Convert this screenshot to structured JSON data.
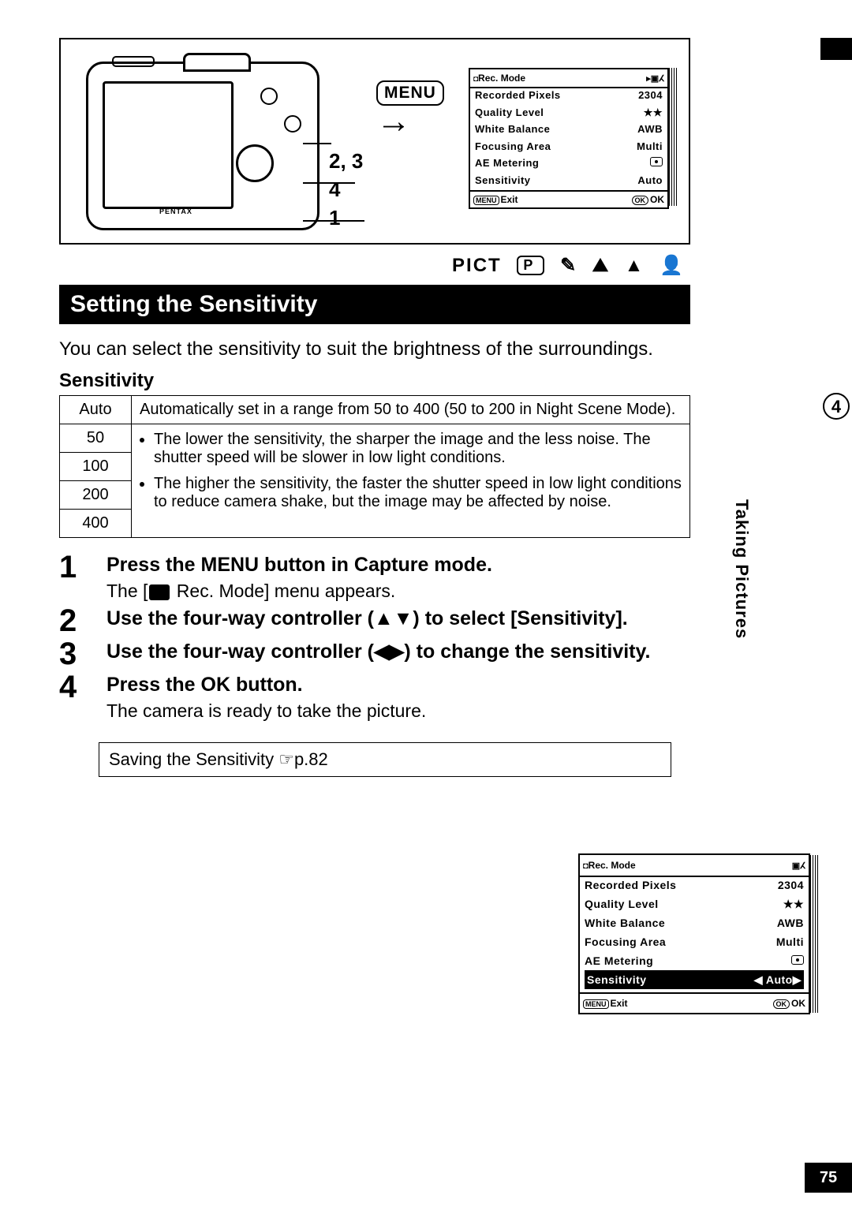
{
  "sidebar": {
    "chapter_number": "4",
    "chapter_title": "Taking Pictures",
    "page_number": "75"
  },
  "diagram": {
    "menu_button": "MENU",
    "step_2_3": "2, 3",
    "step_4": "4",
    "step_1": "1",
    "pentax": "PENTAX"
  },
  "lcd1": {
    "header_title": "Rec. Mode",
    "rows": [
      {
        "label": "Recorded Pixels",
        "value": "2304"
      },
      {
        "label": "Quality Level",
        "value": "★★"
      },
      {
        "label": "White Balance",
        "value": "AWB"
      },
      {
        "label": "Focusing Area",
        "value": "Multi"
      },
      {
        "label": "AE Metering",
        "value": "◉"
      },
      {
        "label": "Sensitivity",
        "value": "Auto"
      }
    ],
    "footer_menu": "MENU",
    "footer_exit": "Exit",
    "footer_ok": "OK",
    "footer_ok2": "OK"
  },
  "mode_row": {
    "pict": "PICT",
    "p": "P",
    "icons": "✎ ⛰ ▲ 👤"
  },
  "section_header": "Setting the Sensitivity",
  "intro": "You can select the sensitivity to suit the brightness of the surroundings.",
  "subhead": "Sensitivity",
  "table": {
    "auto_label": "Auto",
    "auto_desc": "Automatically set in a range from 50 to 400 (50 to 200 in Night Scene Mode).",
    "v50": "50",
    "v100": "100",
    "v200": "200",
    "v400": "400",
    "bullet1": "The lower the sensitivity, the sharper the image and the less noise. The shutter speed will be slower in low light conditions.",
    "bullet2": "The higher the sensitivity, the faster the shutter speed in low light conditions to reduce camera shake, but the image may be affected by noise."
  },
  "steps": {
    "s1": {
      "n": "1",
      "title": "Press the MENU button in Capture mode.",
      "sub_pre": "The [",
      "sub_post": " Rec. Mode] menu appears."
    },
    "s2": {
      "n": "2",
      "title": "Use the four-way controller (▲▼) to select [Sensitivity]."
    },
    "s3": {
      "n": "3",
      "title": "Use the four-way controller (◀▶) to change the sensitivity."
    },
    "s4": {
      "n": "4",
      "title": "Press the OK button.",
      "sub": "The camera is ready to take the picture."
    }
  },
  "lcd2": {
    "header_title": "Rec. Mode",
    "rows": [
      {
        "label": "Recorded Pixels",
        "value": "2304"
      },
      {
        "label": "Quality Level",
        "value": "★★"
      },
      {
        "label": "White Balance",
        "value": "AWB"
      },
      {
        "label": "Focusing Area",
        "value": "Multi"
      },
      {
        "label": "AE Metering",
        "value": "◉"
      },
      {
        "label": "Sensitivity",
        "value": "Auto",
        "highlight": true,
        "arrows": true
      }
    ],
    "footer_menu": "MENU",
    "footer_exit": "Exit",
    "footer_ok": "OK",
    "footer_ok2": "OK"
  },
  "ref": "Saving the Sensitivity ☞p.82"
}
